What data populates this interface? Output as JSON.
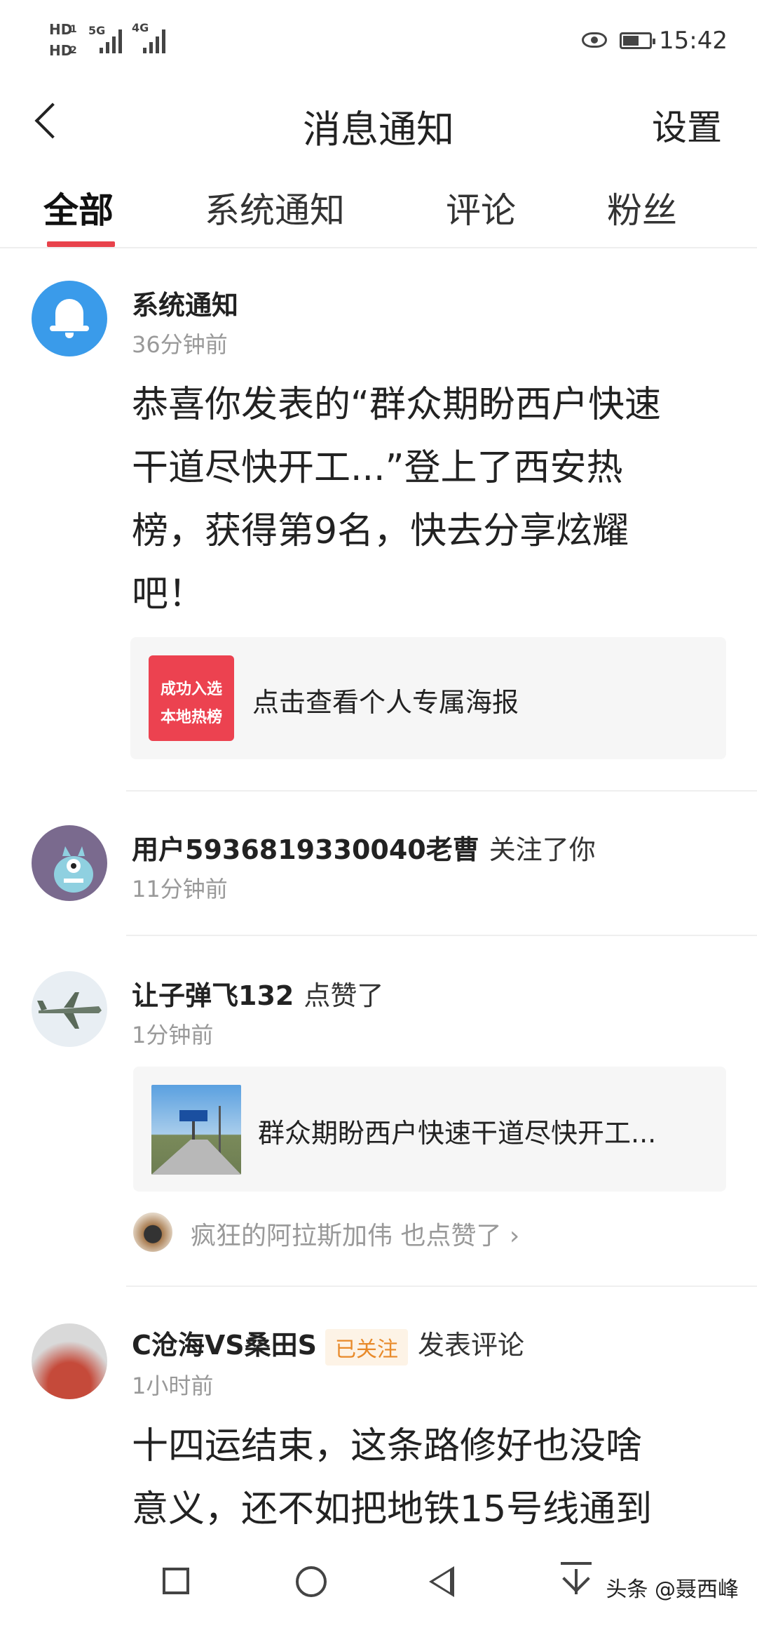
{
  "status_bar": {
    "hd1": "HD",
    "hd1_sub": "1",
    "hd2": "HD",
    "hd2_sub": "2",
    "net1": "5G",
    "net2": "4G",
    "time": "15:42"
  },
  "header": {
    "title": "消息通知",
    "settings_label": "设置"
  },
  "tabs": [
    {
      "label": "全部",
      "active": true
    },
    {
      "label": "系统通知",
      "active": false
    },
    {
      "label": "评论",
      "active": false
    },
    {
      "label": "粉丝",
      "active": false
    }
  ],
  "notifications": {
    "system": {
      "name": "系统通知",
      "time": "36分钟前",
      "body_lines": [
        "恭喜你发表的“群众期盼西户快速",
        "干道尽快开工...”登上了西安热",
        "榜，获得第9名，快去分享炫耀",
        "吧！"
      ],
      "card_tile_line1": "成功入选",
      "card_tile_line2": "本地热榜",
      "card_text": "点击查看个人专属海报"
    },
    "follow": {
      "name": "用户5936819330040老曹",
      "action": "关注了你",
      "time": "11分钟前"
    },
    "like": {
      "name": "让子弹飞132",
      "action": "点赞了",
      "time": "1分钟前",
      "card_text": "群众期盼西户快速干道尽快开工...",
      "also_liked": "疯狂的阿拉斯加伟 也点赞了 ›"
    },
    "comment": {
      "name": "C沧海VS桑田S",
      "badge": "已关注",
      "action": "发表评论",
      "time": "1小时前",
      "body_lines": [
        "十四运结束，这条路修好也没啥",
        "意义，还不如把地铁15号线通到"
      ]
    }
  },
  "bottom_bar": {
    "watermark": "头条 @聂西峰"
  },
  "colors": {
    "accent": "#e8424b",
    "bell_blue": "#3a9bea",
    "badge_orange": "#e88a2a"
  }
}
